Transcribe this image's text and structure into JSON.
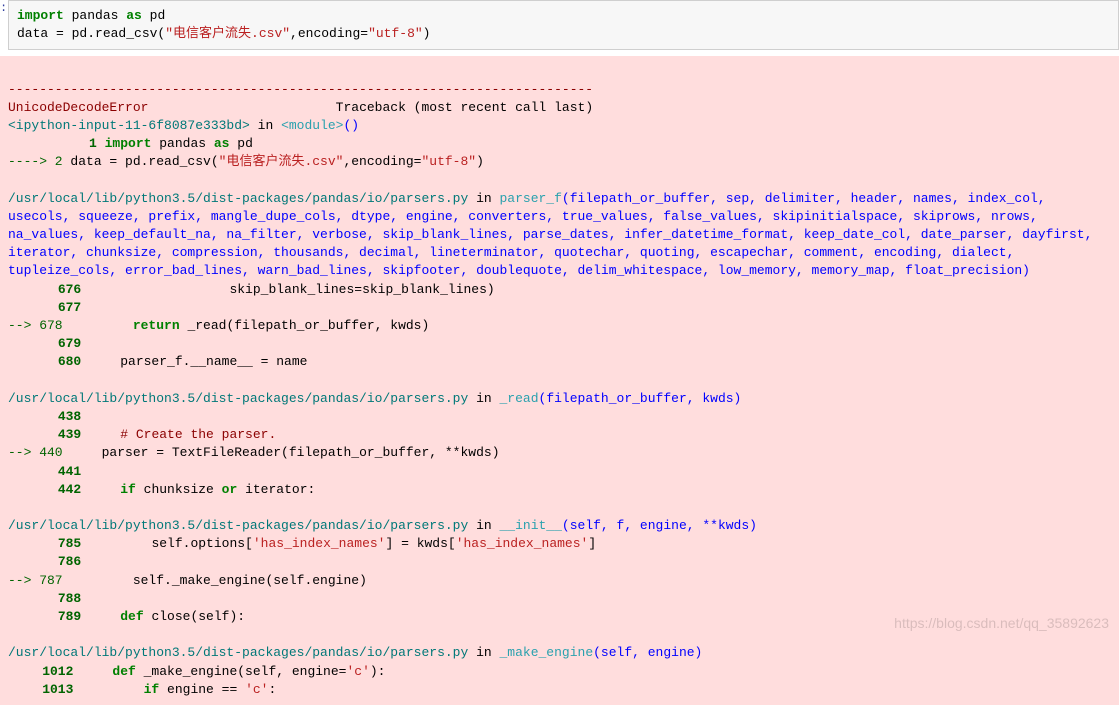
{
  "code_cell": {
    "line1_kw_import": "import",
    "line1_pandas": "pandas",
    "line1_kw_as": "as",
    "line1_pd": "pd",
    "line2_data_eq": "data = pd.read_csv(",
    "line2_str_csv": "\"电信客户流失.csv\"",
    "line2_comma": ",encoding=",
    "line2_str_enc": "\"utf-8\"",
    "line2_close": ")"
  },
  "tb": {
    "sep": "---------------------------------------------------------------------------",
    "err_name": "UnicodeDecodeError",
    "tb_header": "Traceback (most recent call last)",
    "ipy_in": "<ipython-input-11-6f8087e333bd>",
    "in_word": " in ",
    "module": "<module>",
    "module_paren": "()",
    "l1_num": "1",
    "l1_kw": "import",
    "l1_txt": " pandas ",
    "l1_as": "as",
    "l1_pd": " pd",
    "arrow2": "----> 2",
    "l2_pre": " data = pd.read_csv(",
    "l2_csv": "\"电信客户流失.csv\"",
    "l2_mid": ",encoding=",
    "l2_enc": "\"utf-8\"",
    "l2_close": ")",
    "file1": "/usr/local/lib/python3.5/dist-packages/pandas/io/parsers.py",
    "in": " in ",
    "parser_f_name": "parser_f",
    "parser_f_args": "(filepath_or_buffer, sep, delimiter, header, names, index_col, usecols, squeeze, prefix, mangle_dupe_cols, dtype, engine, converters, true_values, false_values, skipinitialspace, skiprows, nrows, na_values, keep_default_na, na_filter, verbose, skip_blank_lines, parse_dates, infer_datetime_format, keep_date_col, date_parser, dayfirst, iterator, chunksize, compression, thousands, decimal, lineterminator, quotechar, quoting, escapechar, comment, encoding, dialect, tupleize_cols, error_bad_lines, warn_bad_lines, skipfooter, doublequote, delim_whitespace, low_memory, memory_map, float_precision)",
    "l676": "676",
    "l676_txt": "                  skip_blank_lines=skip_blank_lines)",
    "l677": "677",
    "arrow678": "--> 678",
    "l678_ret": "return",
    "l678_txt": " _read(filepath_or_buffer, kwds)",
    "l679": "679",
    "l680": "680",
    "l680_txt": "     parser_f.__name__ = name",
    "file2": "/usr/local/lib/python3.5/dist-packages/pandas/io/parsers.py",
    "read_name": "_read",
    "read_args": "(filepath_or_buffer, kwds)",
    "l438": "438",
    "l439": "439",
    "l439_cmt": "# Create the parser.",
    "arrow440": "--> 440",
    "l440_txt": "parser = TextFileReader(filepath_or_buffer, **kwds)",
    "l441": "441",
    "l442": "442",
    "l442_if": "if",
    "l442_txt": " chunksize ",
    "l442_or": "or",
    "l442_it": " iterator:",
    "file3": "/usr/local/lib/python3.5/dist-packages/pandas/io/parsers.py",
    "init_name": "__init__",
    "init_args": "(self, f, engine, **kwds)",
    "l785": "785",
    "l785_txt": "        self.options[",
    "l785_s1": "'has_index_names'",
    "l785_mid": "] = kwds[",
    "l785_s2": "'has_index_names'",
    "l785_close": "]",
    "l786": "786",
    "arrow787": "--> 787",
    "l787_txt": "    self._make_engine(self.engine)",
    "l788": "788",
    "l789": "789",
    "l789_def": "def",
    "l789_txt": " close(self):",
    "file4": "/usr/local/lib/python3.5/dist-packages/pandas/io/parsers.py",
    "make_engine_name": "_make_engine",
    "make_engine_args": "(self, engine)",
    "l1012": "1012",
    "l1012_def": "def",
    "l1012_txt": " _make_engine(self, engine=",
    "l1012_c": "'c'",
    "l1012_close": "):",
    "l1013": "1013",
    "l1013_if": "if",
    "l1013_txt": " engine == ",
    "l1013_c": "'c'",
    "l1013_colon": ":"
  },
  "watermark": "https://blog.csdn.net/qq_35892623"
}
